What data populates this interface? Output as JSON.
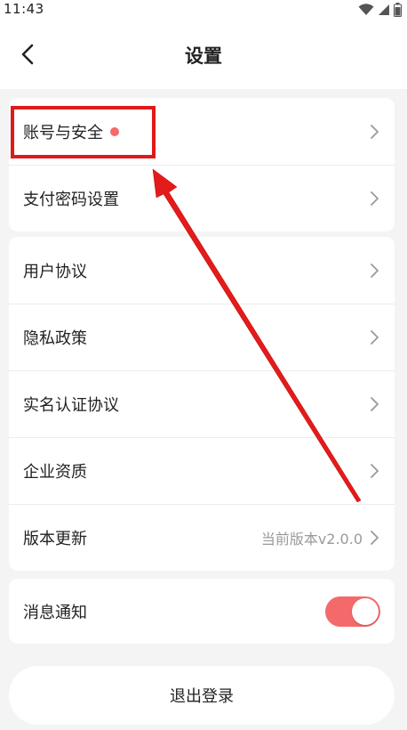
{
  "status_bar": {
    "time": "11:43",
    "icons": [
      "wifi-icon",
      "signal-icon",
      "battery-icon"
    ]
  },
  "header": {
    "title": "设置",
    "back_icon": "back-chevron-icon"
  },
  "groups": [
    {
      "items": [
        {
          "label": "账号与安全",
          "badge": "red-dot"
        },
        {
          "label": "支付密码设置"
        }
      ]
    },
    {
      "items": [
        {
          "label": "用户协议"
        },
        {
          "label": "隐私政策"
        },
        {
          "label": "实名认证协议"
        },
        {
          "label": "企业资质"
        },
        {
          "label": "版本更新",
          "value": "当前版本v2.0.0"
        }
      ]
    },
    {
      "items": [
        {
          "label": "消息通知",
          "toggle_on": true
        }
      ]
    }
  ],
  "logout_label": "退出登录",
  "colors": {
    "accent": "#f46a6a",
    "annotation": "#e01a1a",
    "background": "#f4f4f4"
  }
}
